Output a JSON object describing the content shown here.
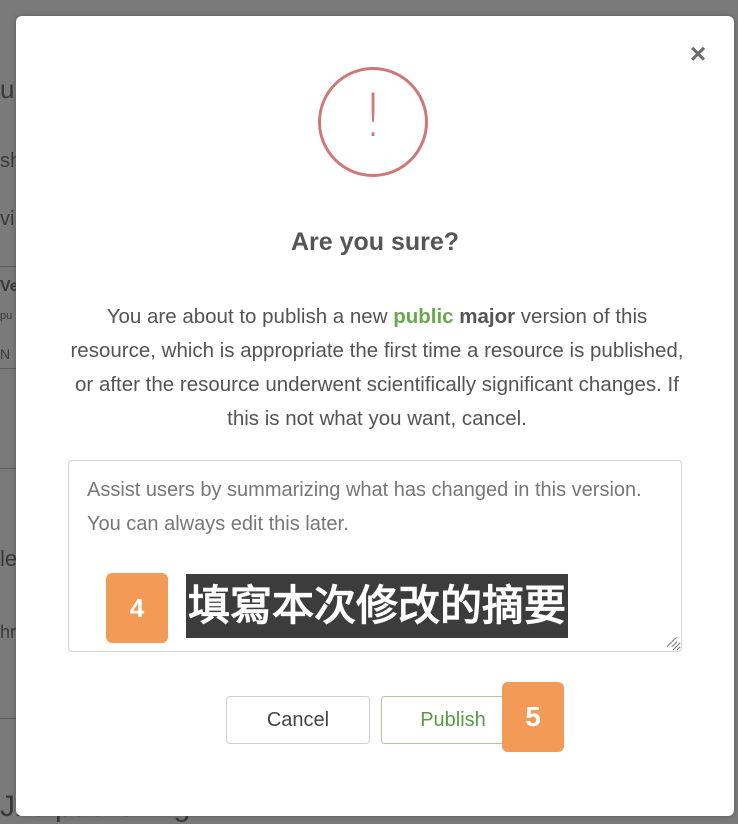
{
  "background_page": {
    "fragments": [
      "u",
      "sh",
      "vi",
      "Ve",
      "pu",
      "N",
      "le",
      "hr"
    ],
    "bottom_text": "Jko publishing"
  },
  "dialog": {
    "close_label": "×",
    "icon": "exclamation-circle-icon",
    "title": "Are you sure?",
    "message": {
      "part1": "You are about to publish a new ",
      "highlight_public": "public",
      "space": " ",
      "highlight_major": "major",
      "part2": " version of this resource, which is appropriate the first time a resource is published, or after the resource underwent scientifically significant changes. If this is not what you want, cancel."
    },
    "summary_placeholder": "Assist users by summarizing what has changed in this version. You can always edit this later.",
    "buttons": {
      "cancel": "Cancel",
      "publish": "Publish"
    }
  },
  "annotations": {
    "step4_number": "4",
    "step4_text": "填寫本次修改的摘要",
    "step5_number": "5"
  },
  "colors": {
    "accent_green": "#6aa84f",
    "warning_red": "#d07878",
    "badge_orange": "#f39a57"
  }
}
